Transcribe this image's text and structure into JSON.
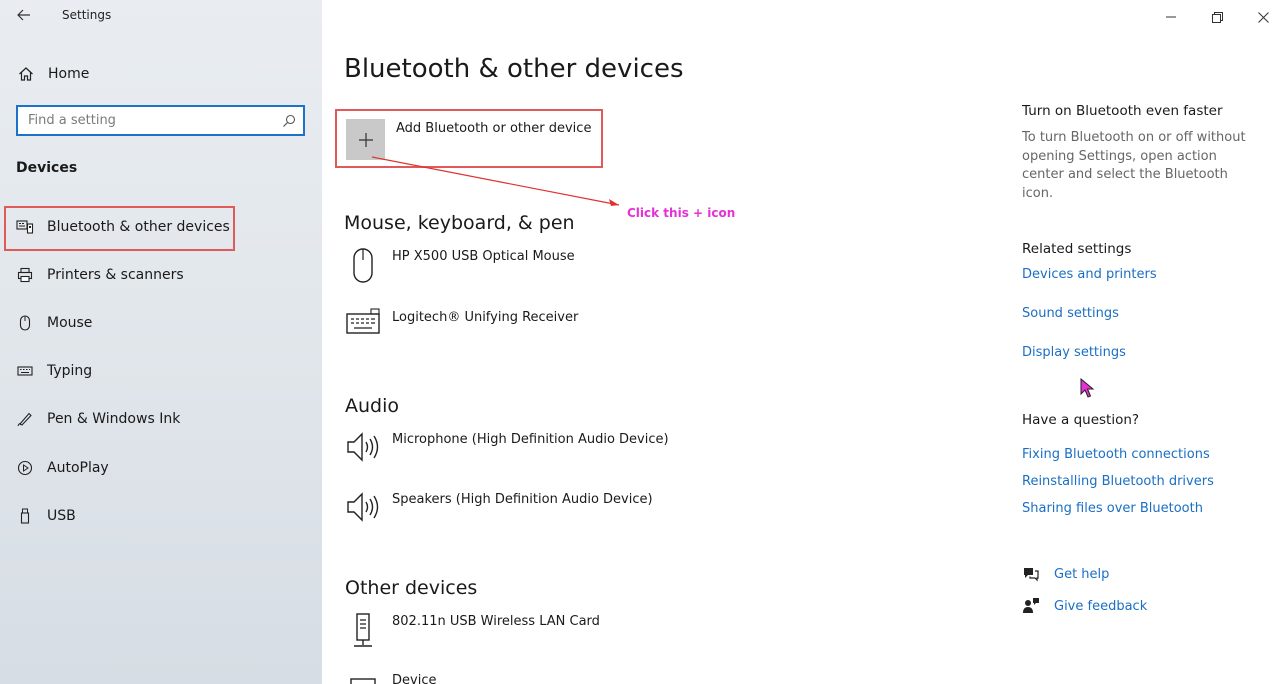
{
  "window": {
    "title": "Settings",
    "back_icon": "back-arrow-icon",
    "controls": [
      "minimize-icon",
      "restore-icon",
      "close-icon"
    ]
  },
  "sidebar": {
    "home_label": "Home",
    "search_placeholder": "Find a setting",
    "section_heading": "Devices",
    "items": [
      {
        "label": "Bluetooth & other devices",
        "icon": "bluetooth-devices-icon",
        "selected": true
      },
      {
        "label": "Printers & scanners",
        "icon": "printer-icon"
      },
      {
        "label": "Mouse",
        "icon": "mouse-icon"
      },
      {
        "label": "Typing",
        "icon": "keyboard-icon"
      },
      {
        "label": "Pen & Windows Ink",
        "icon": "pen-icon"
      },
      {
        "label": "AutoPlay",
        "icon": "autoplay-icon"
      },
      {
        "label": "USB",
        "icon": "usb-icon"
      }
    ]
  },
  "main": {
    "title": "Bluetooth & other devices",
    "add_device_label": "Add Bluetooth or other device",
    "annotation_text": "Click this + icon",
    "sections": [
      {
        "title": "Mouse, keyboard, & pen",
        "devices": [
          {
            "name": "HP X500 USB Optical Mouse",
            "icon": "mouse-icon"
          },
          {
            "name": "Logitech® Unifying Receiver",
            "icon": "keyboard-icon"
          }
        ]
      },
      {
        "title": "Audio",
        "devices": [
          {
            "name": "Microphone (High Definition Audio Device)",
            "icon": "speaker-icon"
          },
          {
            "name": "Speakers (High Definition Audio Device)",
            "icon": "speaker-icon"
          }
        ]
      },
      {
        "title": "Other devices",
        "devices": [
          {
            "name": "802.11n USB Wireless LAN Card",
            "icon": "network-adapter-icon"
          },
          {
            "name": "Device",
            "icon": "generic-device-icon"
          }
        ]
      }
    ]
  },
  "right": {
    "tip_heading": "Turn on Bluetooth even faster",
    "tip_body": "To turn Bluetooth on or off without opening Settings, open action center and select the Bluetooth icon.",
    "related_heading": "Related settings",
    "related_links": [
      "Devices and printers",
      "Sound settings",
      "Display settings"
    ],
    "question_heading": "Have a question?",
    "question_links": [
      "Fixing Bluetooth connections",
      "Reinstalling Bluetooth drivers",
      "Sharing files over Bluetooth"
    ],
    "get_help": "Get help",
    "give_feedback": "Give feedback"
  },
  "colors": {
    "accent": "#1a6fc4",
    "highlight_box": "#e05a5a",
    "annotation": "#e531d5"
  }
}
